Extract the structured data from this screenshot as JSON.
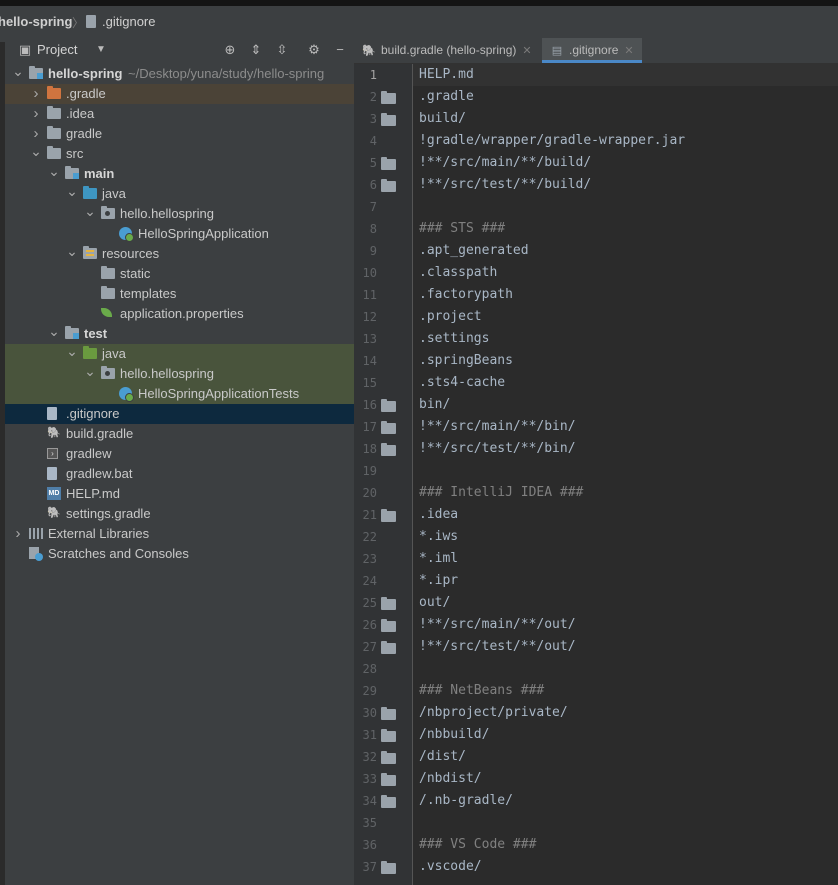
{
  "topbar": {
    "project": "hello-spring",
    "file": ".gitignore"
  },
  "project_panel": {
    "title": "Project",
    "tree": [
      {
        "label": "hello-spring",
        "hint": "~/Desktop/yuna/study/hello-spring",
        "depth": 0,
        "arrow": "open",
        "icon": "module-folder",
        "bold": true
      },
      {
        "label": ".gradle",
        "depth": 1,
        "arrow": "closed",
        "icon": "folder-orange",
        "highlight": "brown"
      },
      {
        "label": ".idea",
        "depth": 1,
        "arrow": "closed",
        "icon": "folder-grey"
      },
      {
        "label": "gradle",
        "depth": 1,
        "arrow": "closed",
        "icon": "folder-grey"
      },
      {
        "label": "src",
        "depth": 1,
        "arrow": "open",
        "icon": "folder-grey"
      },
      {
        "label": "main",
        "depth": 2,
        "arrow": "open",
        "icon": "module-folder",
        "bold": true
      },
      {
        "label": "java",
        "depth": 3,
        "arrow": "open",
        "icon": "folder-blue"
      },
      {
        "label": "hello.hellospring",
        "depth": 4,
        "arrow": "open",
        "icon": "package"
      },
      {
        "label": "HelloSpringApplication",
        "depth": 5,
        "arrow": "none",
        "icon": "spring-class"
      },
      {
        "label": "resources",
        "depth": 3,
        "arrow": "open",
        "icon": "resources"
      },
      {
        "label": "static",
        "depth": 4,
        "arrow": "none",
        "icon": "folder-grey"
      },
      {
        "label": "templates",
        "depth": 4,
        "arrow": "none",
        "icon": "folder-grey"
      },
      {
        "label": "application.properties",
        "depth": 4,
        "arrow": "none",
        "icon": "spring-leaf"
      },
      {
        "label": "test",
        "depth": 2,
        "arrow": "open",
        "icon": "module-folder",
        "bold": true
      },
      {
        "label": "java",
        "depth": 3,
        "arrow": "open",
        "icon": "folder-green",
        "highlight": "green"
      },
      {
        "label": "hello.hellospring",
        "depth": 4,
        "arrow": "open",
        "icon": "package",
        "highlight": "green"
      },
      {
        "label": "HelloSpringApplicationTests",
        "depth": 5,
        "arrow": "none",
        "icon": "spring-class",
        "highlight": "green"
      },
      {
        "label": ".gitignore",
        "depth": 1,
        "arrow": "none",
        "icon": "ignore-file",
        "highlight": "selected"
      },
      {
        "label": "build.gradle",
        "depth": 1,
        "arrow": "none",
        "icon": "gradle"
      },
      {
        "label": "gradlew",
        "depth": 1,
        "arrow": "none",
        "icon": "terminal"
      },
      {
        "label": "gradlew.bat",
        "depth": 1,
        "arrow": "none",
        "icon": "file"
      },
      {
        "label": "HELP.md",
        "depth": 1,
        "arrow": "none",
        "icon": "markdown"
      },
      {
        "label": "settings.gradle",
        "depth": 1,
        "arrow": "none",
        "icon": "gradle"
      },
      {
        "label": "External Libraries",
        "depth": 0,
        "arrow": "closed",
        "icon": "libraries"
      },
      {
        "label": "Scratches and Consoles",
        "depth": 0,
        "arrow": "none",
        "icon": "scratches"
      }
    ]
  },
  "tabs": [
    {
      "label": "build.gradle (hello-spring)",
      "icon": "gradle",
      "active": false
    },
    {
      "label": ".gitignore",
      "icon": "ignore-file",
      "active": true
    }
  ],
  "editor": {
    "lines": [
      {
        "n": "1",
        "text": "HELP.md",
        "folder": false
      },
      {
        "n": "2",
        "text": ".gradle",
        "folder": true
      },
      {
        "n": "3",
        "text": "build/",
        "folder": true
      },
      {
        "n": "4",
        "text": "!gradle/wrapper/gradle-wrapper.jar",
        "folder": false
      },
      {
        "n": "5",
        "text": "!**/src/main/**/build/",
        "folder": true
      },
      {
        "n": "6",
        "text": "!**/src/test/**/build/",
        "folder": true
      },
      {
        "n": "7",
        "text": "",
        "folder": false
      },
      {
        "n": "8",
        "text": "### STS ###",
        "folder": false
      },
      {
        "n": "9",
        "text": ".apt_generated",
        "folder": false
      },
      {
        "n": "10",
        "text": ".classpath",
        "folder": false
      },
      {
        "n": "11",
        "text": ".factorypath",
        "folder": false
      },
      {
        "n": "12",
        "text": ".project",
        "folder": false
      },
      {
        "n": "13",
        "text": ".settings",
        "folder": false
      },
      {
        "n": "14",
        "text": ".springBeans",
        "folder": false
      },
      {
        "n": "15",
        "text": ".sts4-cache",
        "folder": false
      },
      {
        "n": "16",
        "text": "bin/",
        "folder": true
      },
      {
        "n": "17",
        "text": "!**/src/main/**/bin/",
        "folder": true
      },
      {
        "n": "18",
        "text": "!**/src/test/**/bin/",
        "folder": true
      },
      {
        "n": "19",
        "text": "",
        "folder": false
      },
      {
        "n": "20",
        "text": "### IntelliJ IDEA ###",
        "folder": false
      },
      {
        "n": "21",
        "text": ".idea",
        "folder": true
      },
      {
        "n": "22",
        "text": "*.iws",
        "folder": false
      },
      {
        "n": "23",
        "text": "*.iml",
        "folder": false
      },
      {
        "n": "24",
        "text": "*.ipr",
        "folder": false
      },
      {
        "n": "25",
        "text": "out/",
        "folder": true
      },
      {
        "n": "26",
        "text": "!**/src/main/**/out/",
        "folder": true
      },
      {
        "n": "27",
        "text": "!**/src/test/**/out/",
        "folder": true
      },
      {
        "n": "28",
        "text": "",
        "folder": false
      },
      {
        "n": "29",
        "text": "### NetBeans ###",
        "folder": false
      },
      {
        "n": "30",
        "text": "/nbproject/private/",
        "folder": true
      },
      {
        "n": "31",
        "text": "/nbbuild/",
        "folder": true
      },
      {
        "n": "32",
        "text": "/dist/",
        "folder": true
      },
      {
        "n": "33",
        "text": "/nbdist/",
        "folder": true
      },
      {
        "n": "34",
        "text": "/.nb-gradle/",
        "folder": true
      },
      {
        "n": "35",
        "text": "",
        "folder": false
      },
      {
        "n": "36",
        "text": "### VS Code ###",
        "folder": false
      },
      {
        "n": "37",
        "text": ".vscode/",
        "folder": true
      }
    ]
  }
}
